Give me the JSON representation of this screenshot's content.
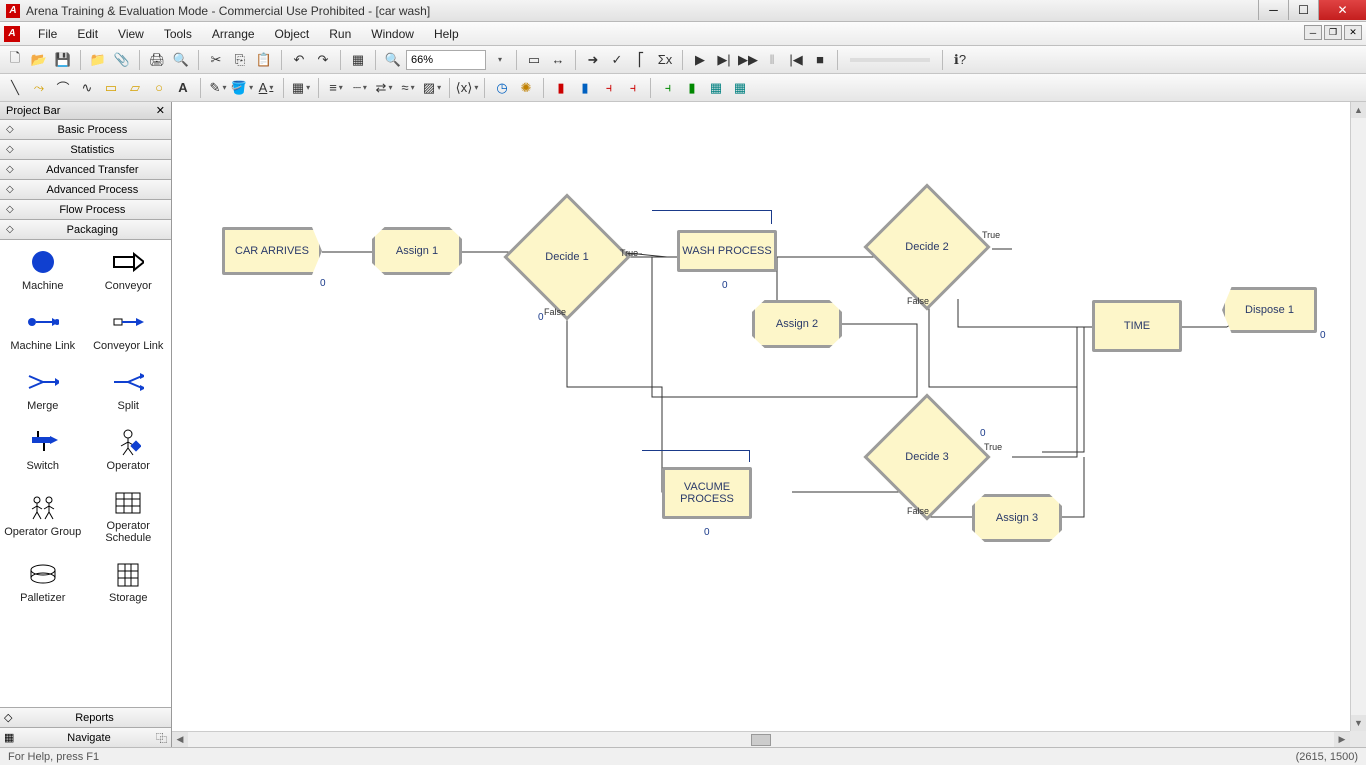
{
  "title": "Arena Training & Evaluation Mode - Commercial Use Prohibited - [car wash]",
  "menu": {
    "file": "File",
    "edit": "Edit",
    "view": "View",
    "tools": "Tools",
    "arrange": "Arrange",
    "object": "Object",
    "run": "Run",
    "window": "Window",
    "help": "Help"
  },
  "zoom": "66%",
  "projectbar": {
    "title": "Project Bar",
    "sections": [
      "Basic Process",
      "Statistics",
      "Advanced Transfer",
      "Advanced Process",
      "Flow Process",
      "Packaging"
    ],
    "palette": [
      {
        "name": "Machine"
      },
      {
        "name": "Conveyor"
      },
      {
        "name": "Machine Link"
      },
      {
        "name": "Conveyor Link"
      },
      {
        "name": "Merge"
      },
      {
        "name": "Split"
      },
      {
        "name": "Switch"
      },
      {
        "name": "Operator"
      },
      {
        "name": "Operator Group"
      },
      {
        "name": "Operator Schedule"
      },
      {
        "name": "Palletizer"
      },
      {
        "name": "Storage"
      }
    ],
    "bottom": [
      "Reports",
      "Navigate"
    ]
  },
  "blocks": {
    "car_arrives": "CAR ARRIVES",
    "assign1": "Assign 1",
    "decide1": "Decide 1",
    "wash": "WASH PROCESS",
    "decide2": "Decide 2",
    "assign2": "Assign 2",
    "time": "TIME",
    "dispose1": "Dispose 1",
    "vacume": "VACUME PROCESS",
    "decide3": "Decide 3",
    "assign3": "Assign 3"
  },
  "labels": {
    "true": "True",
    "false": "False"
  },
  "counters": {
    "zero": "0"
  },
  "status": {
    "help": "For Help, press F1",
    "coords": "(2615, 1500)"
  }
}
